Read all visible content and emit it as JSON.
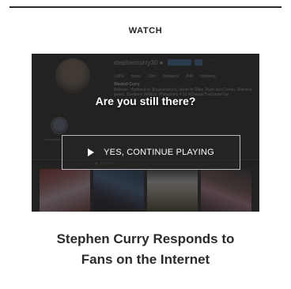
{
  "section": {
    "label": "WATCH"
  },
  "video": {
    "background": {
      "handle": "stephencurry30 ●",
      "more": "···",
      "stats": "1,864 posts  33m followers  848 following",
      "name": "Wardell Curry",
      "bio_line1": "Believer, Husband to @ayeshacurry, father to Riley, Ryan and Canon. Warriors",
      "bio_line2": "guard. Davidson Wildcat. Philippians 4:13 #ChangeTheGameTour",
      "story_label": "Underrated",
      "tab_label": "▦ POSTS"
    },
    "overlay": {
      "prompt": "Are you still there?",
      "continue_label": "YES, CONTINUE PLAYING"
    }
  },
  "article": {
    "headline_line1": "Stephen Curry Responds to",
    "headline_line2": "Fans on the Internet"
  }
}
